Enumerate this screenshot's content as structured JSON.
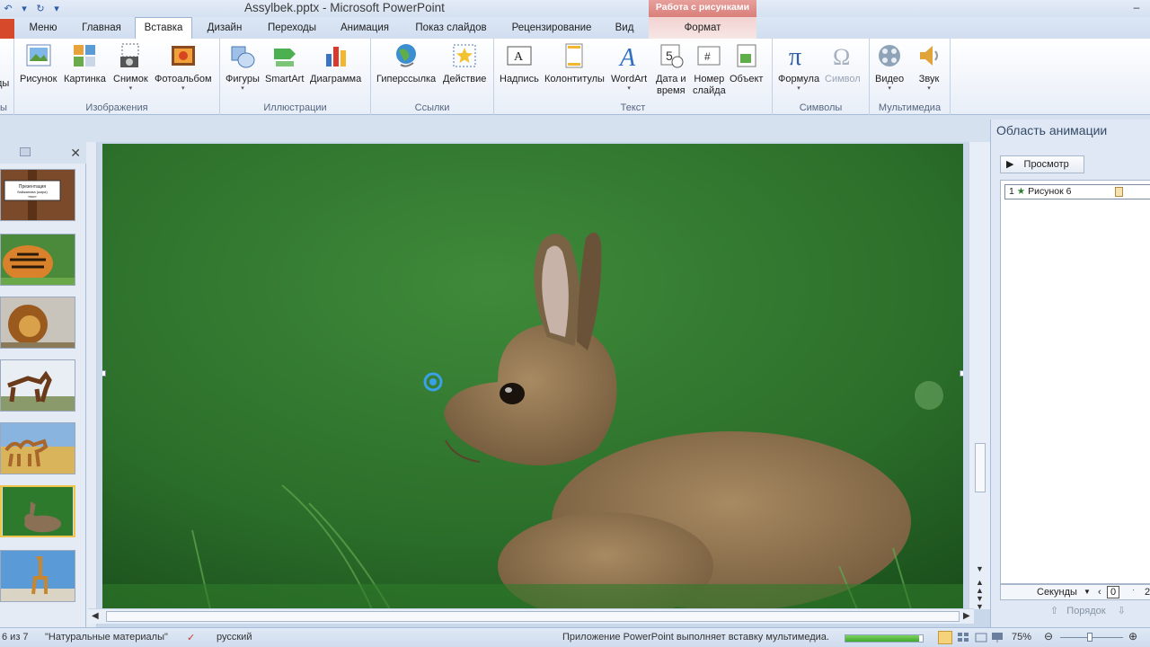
{
  "window": {
    "title": "Assylbek.pptx  -  Microsoft PowerPoint",
    "context_tab_header": "Работа с рисунками"
  },
  "tabs": [
    "Меню",
    "Главная",
    "Вставка",
    "Дизайн",
    "Переходы",
    "Анимация",
    "Показ слайдов",
    "Рецензирование",
    "Вид",
    "Формат"
  ],
  "active_tab": "Вставка",
  "ribbon": {
    "groups": [
      {
        "label": "Изображения",
        "buttons": [
          "Рисунок",
          "Картинка",
          "Снимок",
          "Фотоальбом"
        ]
      },
      {
        "label": "Иллюстрации",
        "buttons": [
          "Фигуры",
          "SmartArt",
          "Диаграмма"
        ]
      },
      {
        "label": "Ссылки",
        "buttons": [
          "Гиперссылка",
          "Действие"
        ]
      },
      {
        "label": "Текст",
        "buttons": [
          "Надпись",
          "Колонтитулы",
          "WordArt",
          "Дата и",
          "время",
          "Номер",
          "слайда",
          "Объект"
        ]
      },
      {
        "label": "Символы",
        "buttons": [
          "Формула",
          "Символ"
        ]
      },
      {
        "label": "Мультимедиа",
        "buttons": [
          "Видео",
          "Звук"
        ]
      }
    ],
    "left_cut_label": "ды",
    "left_cut_group": "ы"
  },
  "thumbnails": {
    "selected_index": 5,
    "first_thumb_text": "Презентация\nбайжанова (жира)\nтекст"
  },
  "animation_pane": {
    "title": "Область анимации",
    "play_label": "Просмотр",
    "item_number": "1",
    "item_label": "Рисунок 6",
    "timing_label": "Секунды",
    "timing_value": "0",
    "timing_next": "2",
    "order_label": "Порядок"
  },
  "status": {
    "slide_counter": "6 из 7",
    "theme": "\"Натуральные материалы\"",
    "language": "русский",
    "message": "Приложение PowerPoint выполняет вставку мультимедиа.",
    "progress_fraction": 0.95,
    "zoom": "75%"
  },
  "colors": {
    "slide_background": "#2b6e2a",
    "selected_thumb_border": "#f0c34a",
    "context_tab": "#d97f7a"
  }
}
